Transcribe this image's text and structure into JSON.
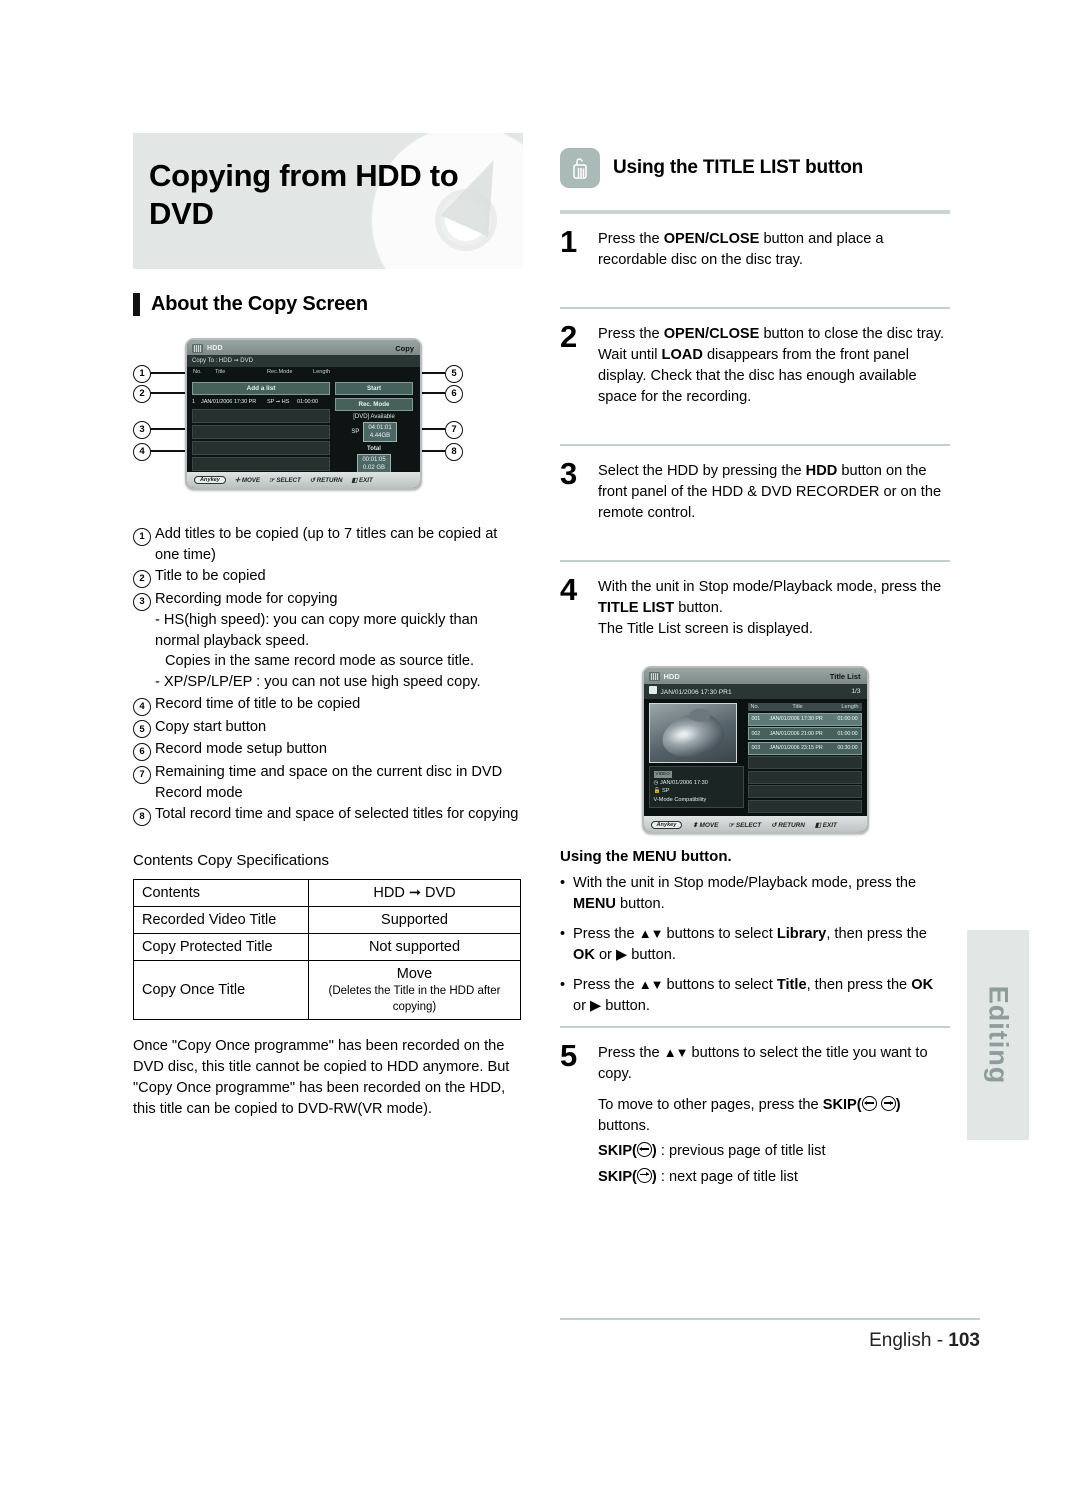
{
  "page": {
    "title_banner": "Copying from HDD to DVD",
    "section_heading": "About the Copy Screen",
    "footer_language": "English - ",
    "footer_page": "103",
    "side_tab": "Editing"
  },
  "copy_screen": {
    "device": "HDD",
    "mode_label": "Copy",
    "copy_to": "Copy To : HDD ➞ DVD",
    "columns": {
      "no": "No.",
      "title": "Title",
      "rec_mode": "Rec.Mode",
      "length": "Length"
    },
    "add_a_list": "Add a list",
    "row": {
      "no": "1",
      "title": "JAN/01/2006 17:30 PR",
      "rec_mode": "SP ➞ HS",
      "length": "01:00:00"
    },
    "start_button": "Start",
    "rec_mode_button": "Rec. Mode",
    "available_label": "[DVD] Available",
    "available_mode": "SP",
    "available_time": "04:01:01",
    "available_size": "4.44GB",
    "total_label": "Total",
    "total_time": "00:01:05",
    "total_size": "0.02 GB",
    "bottom_bar": {
      "anykey": "Anykey",
      "move": "MOVE",
      "select": "SELECT",
      "return": "RETURN",
      "exit": "EXIT"
    },
    "markers": [
      "1",
      "2",
      "3",
      "4",
      "5",
      "6",
      "7",
      "8"
    ]
  },
  "numbered_notes": [
    {
      "n": "1",
      "text": "Add titles to be copied (up to 7 titles can be copied at one time)",
      "sub": []
    },
    {
      "n": "2",
      "text": "Title to be copied",
      "sub": []
    },
    {
      "n": "3",
      "text": "Recording mode for copying",
      "sub": [
        "- HS(high speed): you can copy more quickly than normal playback speed.",
        "Copies in the same record mode as source title.",
        "- XP/SP/LP/EP : you can not use high speed copy."
      ]
    },
    {
      "n": "4",
      "text": "Record time of title to be copied",
      "sub": []
    },
    {
      "n": "5",
      "text": "Copy start button",
      "sub": []
    },
    {
      "n": "6",
      "text": "Record mode setup button",
      "sub": []
    },
    {
      "n": "7",
      "text": "Remaining time and space on the current disc in DVD Record mode",
      "sub": []
    },
    {
      "n": "8",
      "text": "Total record time and space of selected titles for copying",
      "sub": []
    }
  ],
  "spec_table": {
    "caption": "Contents Copy Specifications",
    "headers": [
      "Contents",
      "HDD ➞ DVD"
    ],
    "rows": [
      {
        "k": "Recorded Video Title",
        "v": "Supported",
        "v2": ""
      },
      {
        "k": "Copy Protected Title",
        "v": "Not supported",
        "v2": ""
      },
      {
        "k": "Copy Once Title",
        "v": "Move",
        "v2": "(Deletes the Title in the HDD after copying)"
      }
    ]
  },
  "copy_once_note": "Once \"Copy Once programme\" has been recorded on the DVD disc, this title cannot be copied to HDD anymore. But \"Copy Once programme\" has been recorded on the HDD, this title can be copied to DVD-RW(VR mode).",
  "right": {
    "heading": "Using the TITLE LIST button",
    "steps": [
      {
        "n": "1",
        "html": "Press the <b>OPEN/CLOSE</b> button and place a recordable disc on the disc tray."
      },
      {
        "n": "2",
        "html": "Press the <b>OPEN/CLOSE</b> button to close the disc tray. Wait until <b>LOAD</b> disappears from the front panel display. Check that the disc has enough available space for the recording."
      },
      {
        "n": "3",
        "html": "Select the HDD by pressing the <b>HDD</b> button on the front panel of the HDD &amp; DVD RECORDER or on the remote control."
      },
      {
        "n": "4",
        "html": "With the unit in Stop mode/Playback mode, press the <b>TITLE LIST</b> button.<br>The Title List screen is displayed."
      }
    ],
    "step5": {
      "n": "5",
      "line1": "Press the ▲▼ buttons to select the title you want to copy.",
      "line2_a": "To move to other pages, press the ",
      "line2_b": "SKIP(",
      "line2_c": ") buttons.",
      "prev": " : previous page of title list",
      "next": " : next page of title list",
      "skip_label": "SKIP("
    },
    "menu_section": {
      "heading": "Using the MENU button.",
      "bullets": [
        "With the unit in Stop mode/Playback mode, press the MENU button.",
        "Press the ▲▼ buttons to select Library, then press the OK or ▶ button.",
        "Press the ▲▼ buttons to select Title, then press the OK or ▶ button."
      ]
    }
  },
  "title_list_screen": {
    "device": "HDD",
    "mode_label": "Title List",
    "current": "JAN/01/2006 17:30 PR1",
    "page_indicator": "1/3",
    "columns": {
      "no": "No.",
      "title": "Title",
      "length": "Length"
    },
    "rows": [
      {
        "no": "001",
        "title": "JAN/01/2006 17:30 PR",
        "length": "01:00:00",
        "selected": true
      },
      {
        "no": "002",
        "title": "JAN/01/2006 21:00 PR",
        "length": "01:00:00",
        "selected": false
      },
      {
        "no": "003",
        "title": "JAN/01/2006 23:15 PR",
        "length": "00:30:00",
        "selected": false
      }
    ],
    "info": {
      "badge": "VIDEO",
      "date": "JAN/01/2006 17:30",
      "mode": "SP",
      "compat": "V-Mode Compatibility"
    },
    "bottom_bar": {
      "anykey": "Anykey",
      "move": "MOVE",
      "select": "SELECT",
      "return": "RETURN",
      "exit": "EXIT"
    }
  }
}
